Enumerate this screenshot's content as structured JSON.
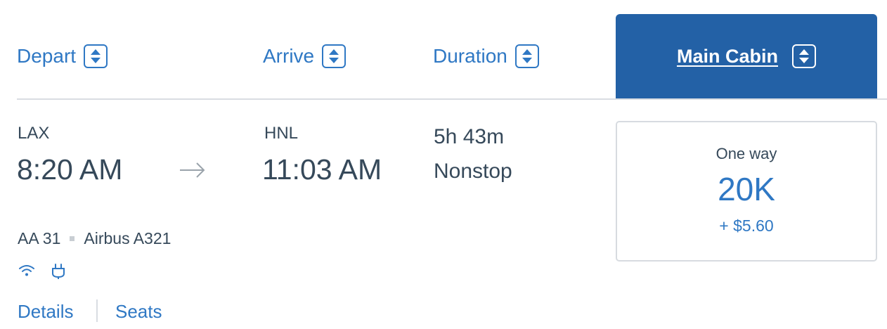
{
  "header": {
    "depart_label": "Depart",
    "arrive_label": "Arrive",
    "duration_label": "Duration",
    "main_cabin_label": "Main Cabin"
  },
  "flight": {
    "origin": "LAX",
    "depart_time": "8:20 AM",
    "destination": "HNL",
    "arrive_time": "11:03 AM",
    "duration": "5h 43m",
    "stops": "Nonstop",
    "flight_number": "AA 31",
    "aircraft": "Airbus A321",
    "amenities": [
      "wifi-icon",
      "power-outlet-icon"
    ]
  },
  "fare": {
    "type": "One way",
    "miles": "20K",
    "taxes": "+ $5.60"
  },
  "links": {
    "details": "Details",
    "seats": "Seats"
  },
  "colors": {
    "accent": "#2f78c4",
    "tab_background": "#2361a6",
    "text": "#36495a",
    "divider": "#d9dde2"
  }
}
